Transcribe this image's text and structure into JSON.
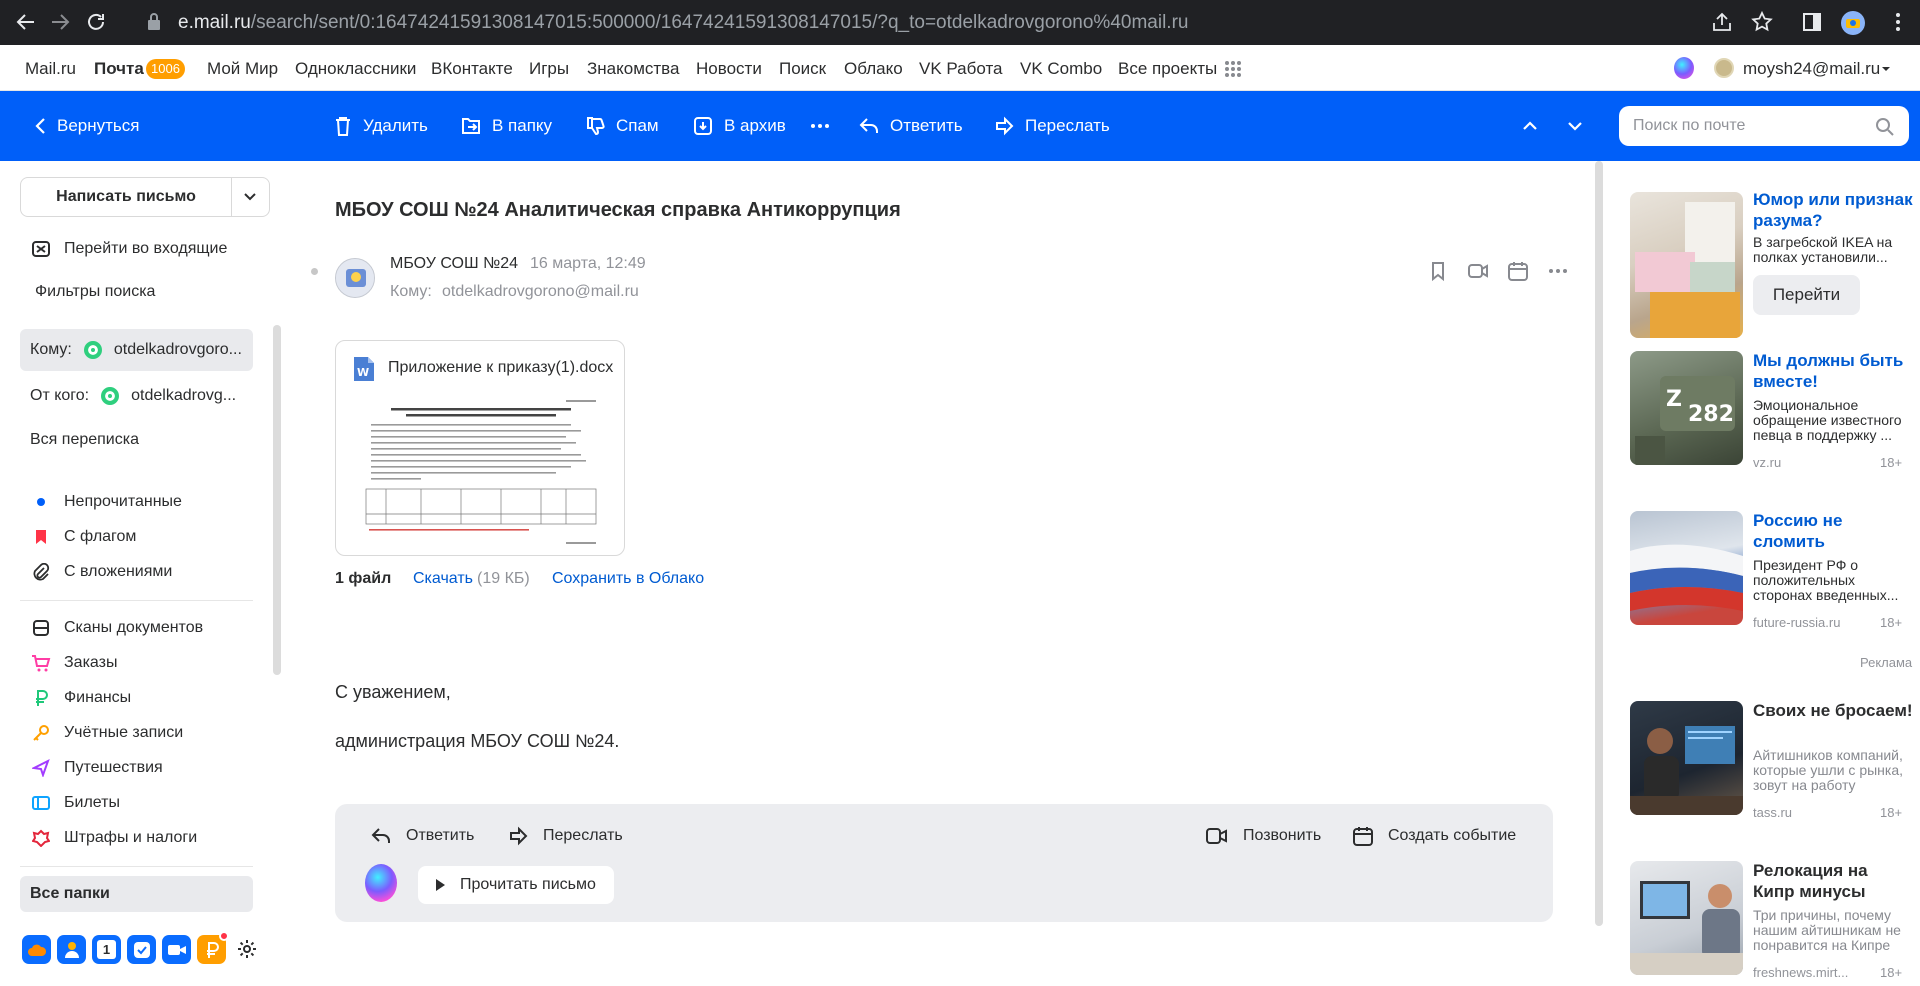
{
  "browser": {
    "url_host": "e.mail.ru",
    "url_path": "/search/sent/0:16474241591308147015:500000/16474241591308147015/?q_to=otdelkadrovgorono%40mail.ru"
  },
  "portal": {
    "links": [
      "Mail.ru",
      "Почта",
      "Мой Мир",
      "Одноклассники",
      "ВКонтакте",
      "Игры",
      "Знакомства",
      "Новости",
      "Поиск",
      "Облако",
      "VK Работа",
      "VK Combo",
      "Все проекты"
    ],
    "mail_badge": "1006",
    "user_email": "moysh24@mail.ru"
  },
  "toolbar": {
    "back": "Вернуться",
    "delete": "Удалить",
    "to_folder": "В папку",
    "spam": "Спам",
    "archive": "В архив",
    "reply": "Ответить",
    "forward": "Переслать",
    "search_placeholder": "Поиск по почте"
  },
  "sidebar": {
    "compose": "Написать письмо",
    "goto_inbox": "Перейти во входящие",
    "search_filters": "Фильтры поиска",
    "to_label": "Кому:",
    "to_value": "otdelkadrovgoro...",
    "from_label": "От кого:",
    "from_value": "otdelkadrovg...",
    "all_correspondence": "Вся переписка",
    "filters": [
      "Непрочитанные",
      "С флагом",
      "С вложениями"
    ],
    "categories": [
      "Сканы документов",
      "Заказы",
      "Финансы",
      "Учётные записи",
      "Путешествия",
      "Билеты",
      "Штрафы и налоги"
    ],
    "all_folders": "Все папки",
    "calendar_day": "1"
  },
  "message": {
    "subject": "МБОУ СОШ №24 Аналитическая справка Антикоррупция",
    "sender": "МБОУ СОШ №24",
    "date": "16 марта, 12:49",
    "to_label": "Кому:",
    "to": "otdelkadrovgorono@mail.ru",
    "attachment_name": "Приложение к приказу(1).docx",
    "attachment_count": "1 файл",
    "download": "Скачать",
    "size": "(19 КБ)",
    "save_cloud": "Сохранить в Облако",
    "body_line1": "С уважением,",
    "body_line2": "администрация МБОУ СОШ №24."
  },
  "reply_panel": {
    "reply": "Ответить",
    "forward": "Переслать",
    "call": "Позвонить",
    "create_event": "Создать событие",
    "read_letter": "Прочитать письмо"
  },
  "ads": [
    {
      "title": "Юмор или признак разума?",
      "desc": "В загребской IKEA на полках установили...",
      "button": "Перейти"
    },
    {
      "title": "Мы должны быть вместе!",
      "desc": "Эмоциональное обращение известного певца в поддержку ...",
      "source": "vz.ru",
      "age": "18+"
    },
    {
      "title": "Россию не сломить",
      "desc": "Президент РФ о положительных сторонах введенных...",
      "source": "future-russia.ru",
      "age": "18+"
    },
    {
      "title": "Своих не бросаем!",
      "desc": "Айтишников компаний, которые ушли с рынка, зовут на работу",
      "source": "tass.ru",
      "age": "18+"
    },
    {
      "title": "Релокация на Кипр минусы",
      "desc": "Три причины, почему нашим айтишникам не понравится на Кипре",
      "source": "freshnews.mirt...",
      "age": "18+"
    }
  ],
  "ad_label": "Реклама",
  "colors": {
    "toolbar": "#005ff9",
    "link": "#005bd1",
    "badge": "#ff9e00"
  }
}
